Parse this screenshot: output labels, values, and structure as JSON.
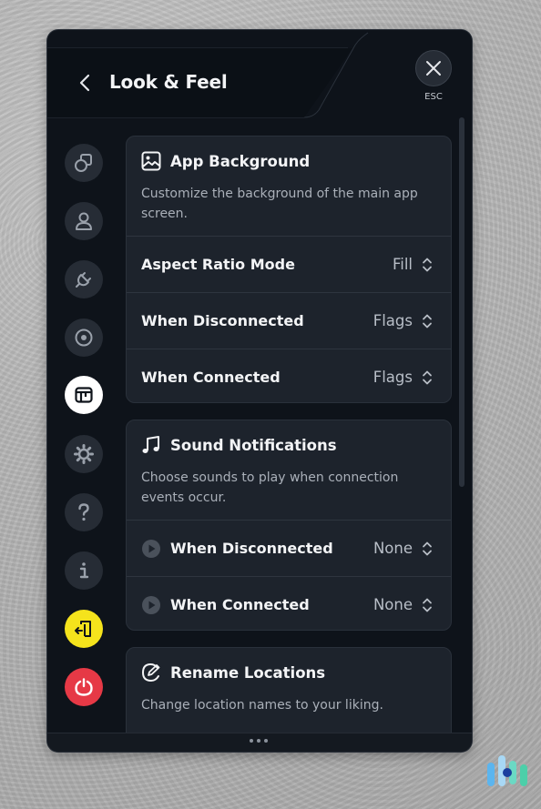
{
  "header": {
    "title": "Look & Feel",
    "close_hint": "ESC"
  },
  "sidebar": {
    "items": [
      {
        "id": "split-tunneling",
        "icon": "shapes-icon"
      },
      {
        "id": "account",
        "icon": "user-icon"
      },
      {
        "id": "connection",
        "icon": "plug-icon"
      },
      {
        "id": "preferences",
        "icon": "target-icon"
      },
      {
        "id": "look-and-feel",
        "icon": "window-icon",
        "active": true
      },
      {
        "id": "general",
        "icon": "gear-icon"
      },
      {
        "id": "help",
        "icon": "question-icon"
      },
      {
        "id": "about",
        "icon": "info-icon"
      },
      {
        "id": "logout",
        "icon": "exit-icon",
        "color": "#f5e31c"
      },
      {
        "id": "quit",
        "icon": "power-icon",
        "color": "#e63946"
      }
    ]
  },
  "app_background": {
    "title": "App Background",
    "description": "Customize the background of the main app screen.",
    "rows": [
      {
        "label": "Aspect Ratio Mode",
        "value": "Fill"
      },
      {
        "label": "When Disconnected",
        "value": "Flags"
      },
      {
        "label": "When Connected",
        "value": "Flags"
      }
    ]
  },
  "sound_notifications": {
    "title": "Sound Notifications",
    "description": "Choose sounds to play when connection events occur.",
    "rows": [
      {
        "label": "When Disconnected",
        "value": "None"
      },
      {
        "label": "When Connected",
        "value": "None"
      }
    ]
  },
  "rename_locations": {
    "title": "Rename Locations",
    "description": "Change location names to your liking."
  },
  "colors": {
    "window_bg": "#0e131a",
    "card_bg": "#1d232c",
    "text_primary": "#f3f4f6",
    "text_secondary": "#aab0b9"
  }
}
